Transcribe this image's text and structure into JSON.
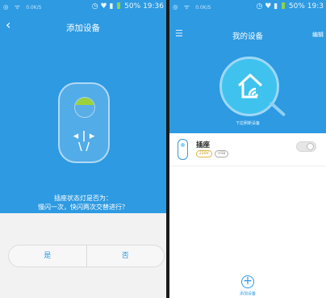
{
  "left_screen": {
    "status_bar": {
      "net": "0.0K/S",
      "battery": "50%",
      "time": "19:36"
    },
    "title": "添加设备",
    "question": "插座状态灯是否为：",
    "question_detail": "慢闪一次，快闪两次交替进行？",
    "yes_label": "是",
    "no_label": "否"
  },
  "right_screen": {
    "status_bar": {
      "net": "0.0K/S",
      "battery": "50%",
      "time": "19:3"
    },
    "title": "我的设备",
    "edit_label": "编辑",
    "pull_hint": "下拉刷新设备",
    "devices": [
      {
        "name": "插座",
        "chips": [
          "220V",
          "USB"
        ],
        "switch_on": false
      }
    ],
    "add_label": "添加设备"
  },
  "colors": {
    "primary": "#2d9ae2",
    "circle": "#3fc3ee",
    "led": "#9bd23b"
  },
  "icons": {
    "back": "back-icon",
    "menu": "menu-icon",
    "home": "home-wifi-icon",
    "plug": "plug-icon",
    "add": "add-icon"
  }
}
